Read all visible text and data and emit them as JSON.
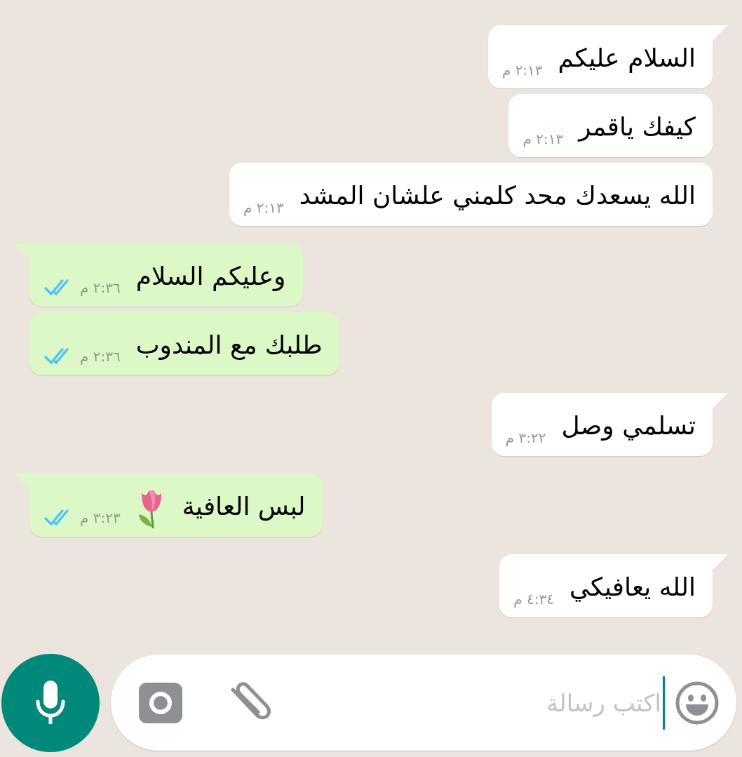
{
  "messages": [
    {
      "kind": "incoming",
      "tail": true,
      "text": "السلام عليكم",
      "time": "٢:١٣ م"
    },
    {
      "kind": "incoming",
      "tail": false,
      "text": "كيفك ياقمر",
      "time": "٢:١٣ م"
    },
    {
      "kind": "incoming",
      "tail": false,
      "text": "الله يسعدك محد كلمني علشان المشد",
      "time": "٢:١٣ م"
    },
    {
      "kind": "outgoing",
      "tail": true,
      "text": "وعليكم السلام",
      "time": "٢:٣٦ م",
      "read": true
    },
    {
      "kind": "outgoing",
      "tail": false,
      "text": "طلبك مع المندوب",
      "time": "٢:٣٦ م",
      "read": true
    },
    {
      "kind": "incoming",
      "tail": true,
      "text": "تسلمي وصل",
      "time": "٣:٢٢ م"
    },
    {
      "kind": "outgoing",
      "tail": true,
      "text": "لبس العافية",
      "tulip": true,
      "time": "٣:٢٣ م",
      "read": true
    },
    {
      "kind": "incoming",
      "tail": true,
      "text": "الله يعافيكي",
      "time": "٤:٣٤ م"
    }
  ],
  "composer": {
    "placeholder": "اكتب رسالة"
  }
}
